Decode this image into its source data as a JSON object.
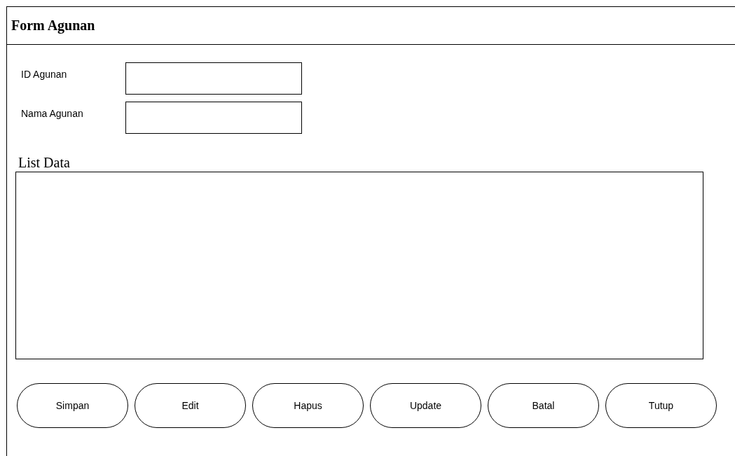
{
  "window": {
    "title": "Form Agunan"
  },
  "fields": [
    {
      "label": "ID Agunan"
    },
    {
      "label": "Nama Agunan"
    }
  ],
  "list": {
    "title": "List Data"
  },
  "buttons": [
    "Simpan",
    "Edit",
    "Hapus",
    "Update",
    "Batal",
    "Tutup"
  ]
}
